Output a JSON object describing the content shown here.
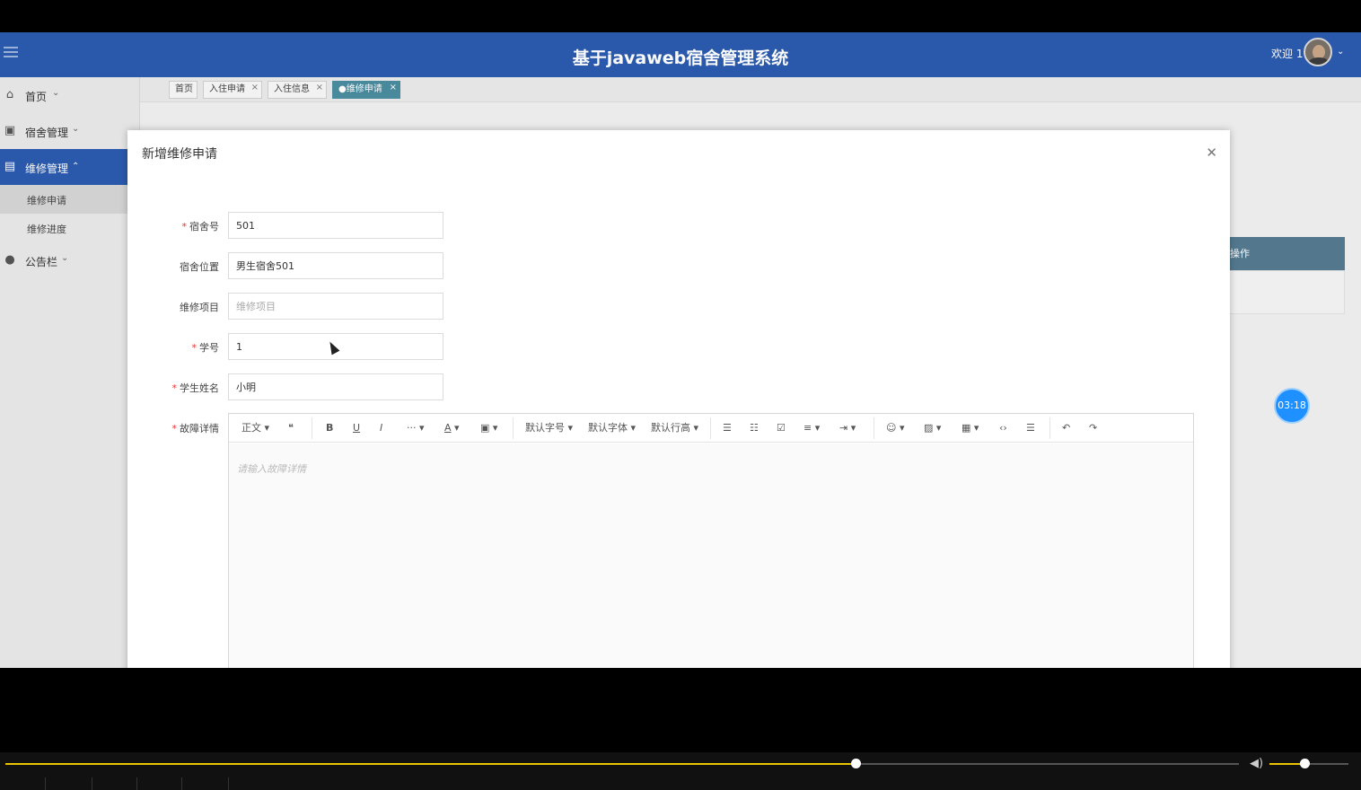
{
  "header": {
    "title": "基于javaweb宿舍管理系统",
    "welcome": "欢迎 1"
  },
  "sidebar": {
    "items": [
      {
        "label": "首页",
        "icon": "home-icon"
      },
      {
        "label": "宿舍管理",
        "icon": "building-icon"
      },
      {
        "label": "维修管理",
        "icon": "wrench-icon"
      },
      {
        "label": "公告栏",
        "icon": "bulletin-icon"
      }
    ],
    "sub_items": [
      {
        "label": "维修申请"
      },
      {
        "label": "维修进度"
      }
    ]
  },
  "tabs": [
    {
      "label": "首页"
    },
    {
      "label": "入住申请"
    },
    {
      "label": "入住信息"
    },
    {
      "label": "●维修申请"
    }
  ],
  "background": {
    "table_header": "操作"
  },
  "timer": "03:18",
  "modal": {
    "title": "新增维修申请",
    "fields": {
      "dorm_no": {
        "label": "宿舍号",
        "value": "501",
        "required": true
      },
      "dorm_location": {
        "label": "宿舍位置",
        "value": "男生宿舍501",
        "required": false
      },
      "repair_item": {
        "label": "维修项目",
        "placeholder": "维修项目",
        "required": false
      },
      "student_id": {
        "label": "学号",
        "value": "1",
        "required": true
      },
      "student_name": {
        "label": "学生姓名",
        "value": "小明",
        "required": true
      },
      "fault_detail": {
        "label": "故障详情",
        "placeholder": "请输入故障详情",
        "required": true
      }
    },
    "required_mark": "*"
  },
  "editor_toolbar": {
    "paragraph": "正文",
    "font_size": "默认字号",
    "font_family": "默认字体",
    "line_height": "默认行高",
    "more": "···",
    "text_color": "A"
  },
  "player": {
    "progress": 0.689,
    "volume": 0.44
  },
  "colors": {
    "header_bg": "#2b5bb0",
    "active_tab": "#4a8ca0",
    "progress": "#e8c500",
    "timer": "#1e90ff"
  }
}
